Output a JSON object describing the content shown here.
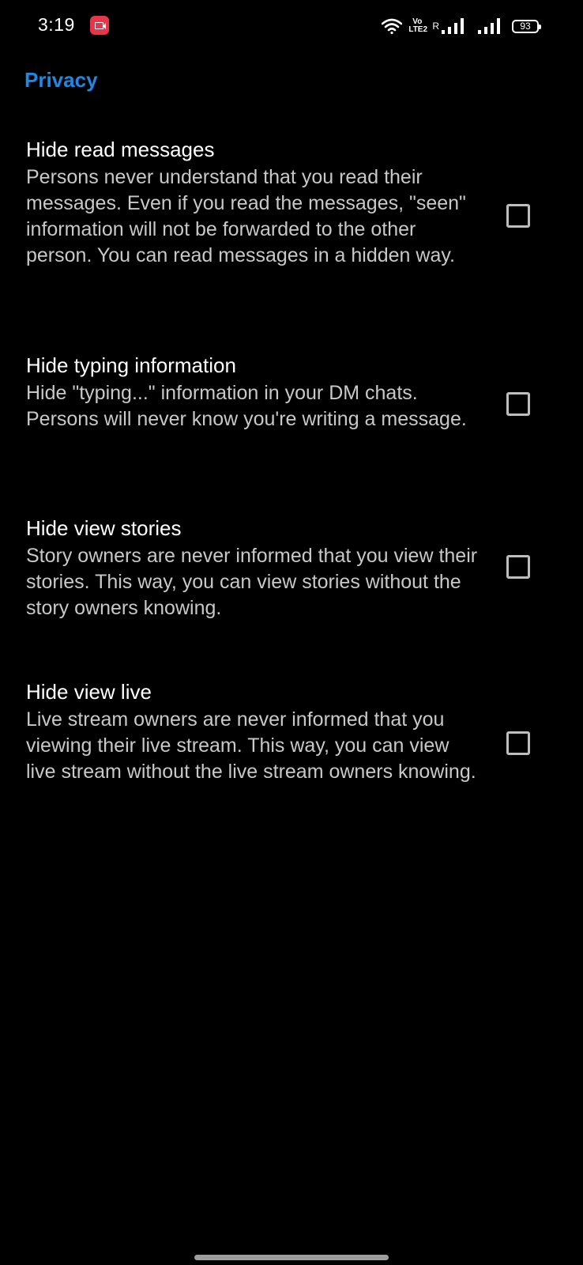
{
  "status_bar": {
    "time": "3:19",
    "volte_top": "Vo",
    "volte_bottom": "LTE2",
    "roaming": "R",
    "battery": "93"
  },
  "header": {
    "title": "Privacy"
  },
  "settings": [
    {
      "title": "Hide read messages",
      "description": "Persons never understand that you read their messages. Even if you read the messages, \"seen\" information will not be forwarded to the other person. You can read messages in a hidden way.",
      "checked": false
    },
    {
      "title": "Hide typing information",
      "description": "Hide \"typing...\" information in your DM chats. Persons will never know you're writing a message.",
      "checked": false
    },
    {
      "title": "Hide view stories",
      "description": "Story owners are never informed that you view their stories. This way, you can view stories without the story owners knowing.",
      "checked": false
    },
    {
      "title": "Hide view live",
      "description": "Live stream owners are never informed that you viewing their live stream. This way, you can view live stream without the live stream owners knowing.",
      "checked": false
    }
  ],
  "colors": {
    "background": "#000000",
    "accent": "#1e88e5",
    "checkbox_border": "#bdbdbd"
  }
}
